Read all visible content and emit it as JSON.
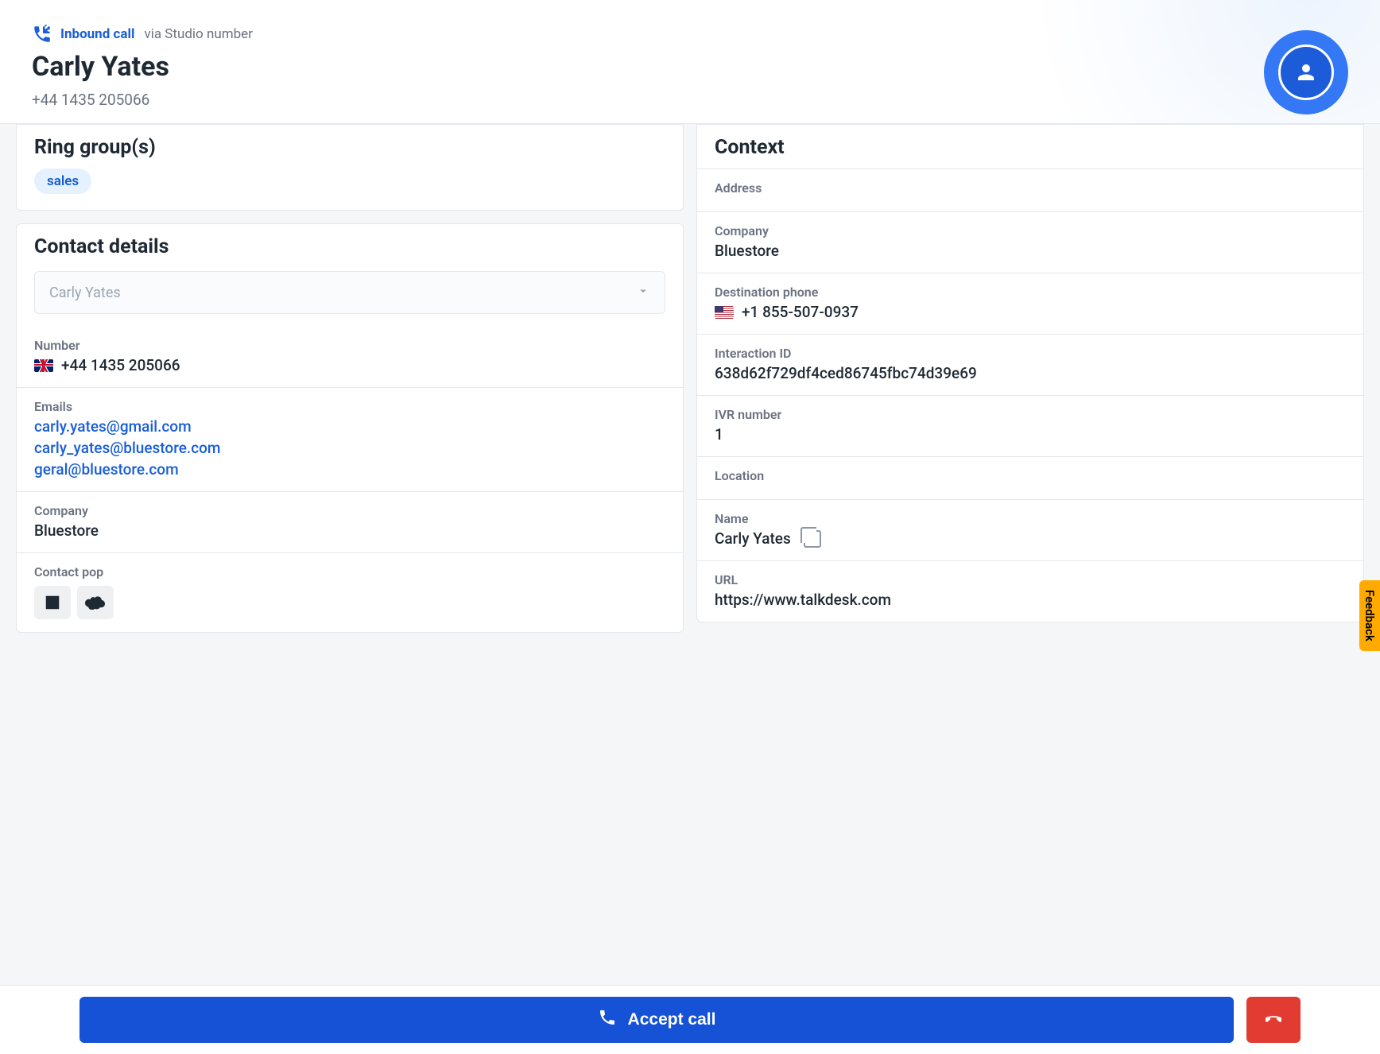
{
  "header": {
    "call_type_label": "Inbound call",
    "via_text": "via Studio number",
    "caller_name": "Carly Yates",
    "caller_phone": "+44 1435 205066"
  },
  "ring_groups": {
    "title": "Ring group(s)",
    "chips": [
      "sales"
    ]
  },
  "contact_details": {
    "title": "Contact details",
    "selected_contact": "Carly Yates",
    "number_label": "Number",
    "number_value": "+44 1435 205066",
    "emails_label": "Emails",
    "emails": [
      "carly.yates@gmail.com",
      "carly_yates@bluestore.com",
      "geral@bluestore.com"
    ],
    "company_label": "Company",
    "company_value": "Bluestore",
    "contact_pop_label": "Contact pop"
  },
  "context": {
    "title": "Context",
    "address_label": "Address",
    "company_label": "Company",
    "company_value": "Bluestore",
    "dest_phone_label": "Destination phone",
    "dest_phone_value": "+1 855-507-0937",
    "interaction_id_label": "Interaction ID",
    "interaction_id_value": "638d62f729df4ced86745fbc74d39e69",
    "ivr_label": "IVR number",
    "ivr_value": "1",
    "location_label": "Location",
    "name_label": "Name",
    "name_value": "Carly Yates",
    "url_label": "URL",
    "url_value": "https://www.talkdesk.com"
  },
  "footer": {
    "accept_label": "Accept call"
  },
  "feedback_tab": "Feedback"
}
